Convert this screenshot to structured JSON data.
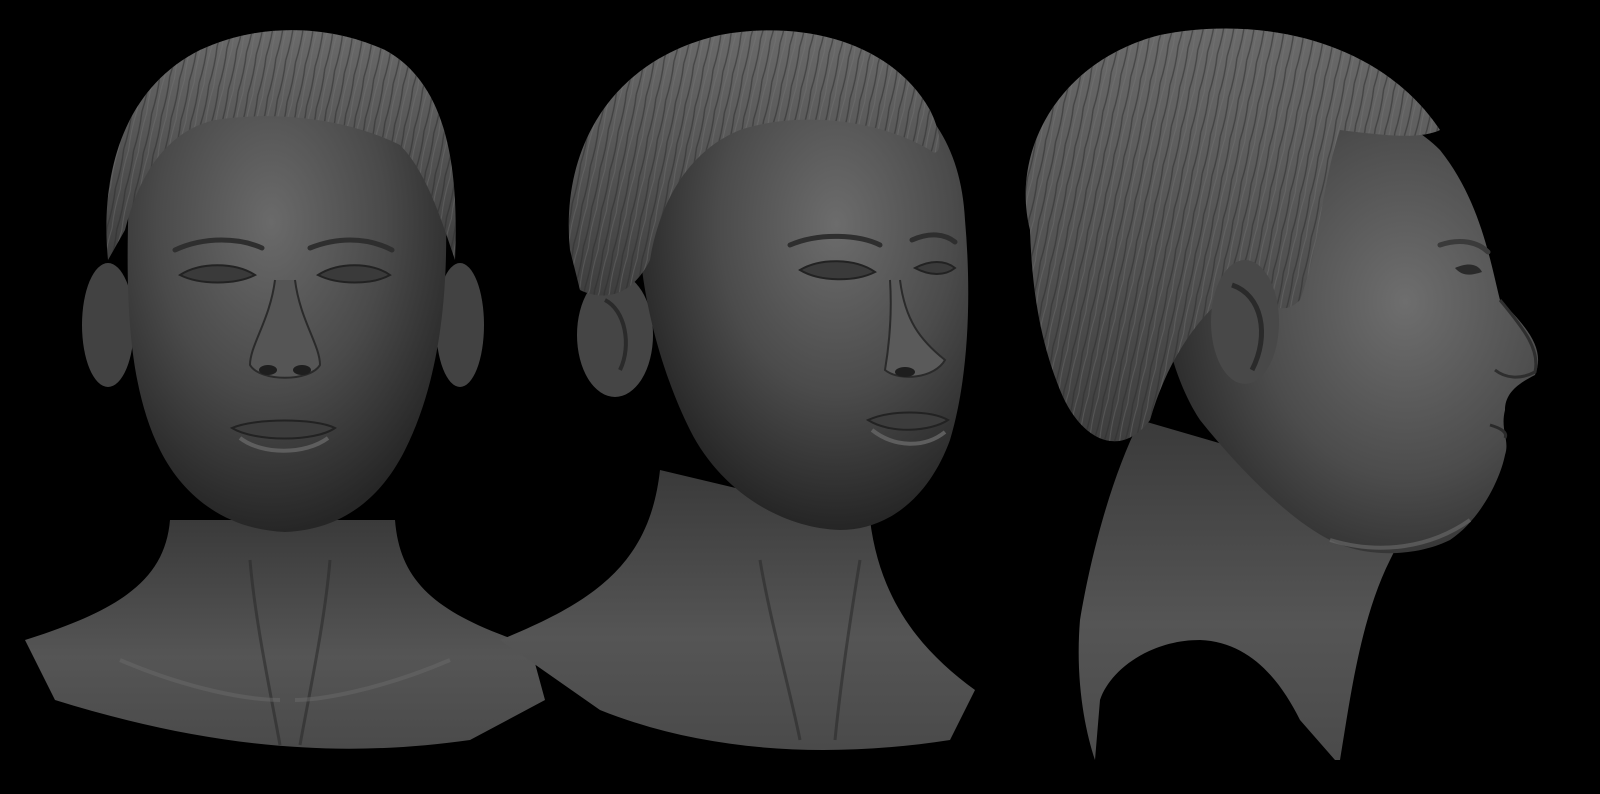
{
  "image": {
    "background_color": "#000000",
    "clay_color": "#4a4a4a",
    "views": [
      {
        "name": "front-view"
      },
      {
        "name": "three-quarter-view"
      },
      {
        "name": "profile-view"
      }
    ]
  }
}
